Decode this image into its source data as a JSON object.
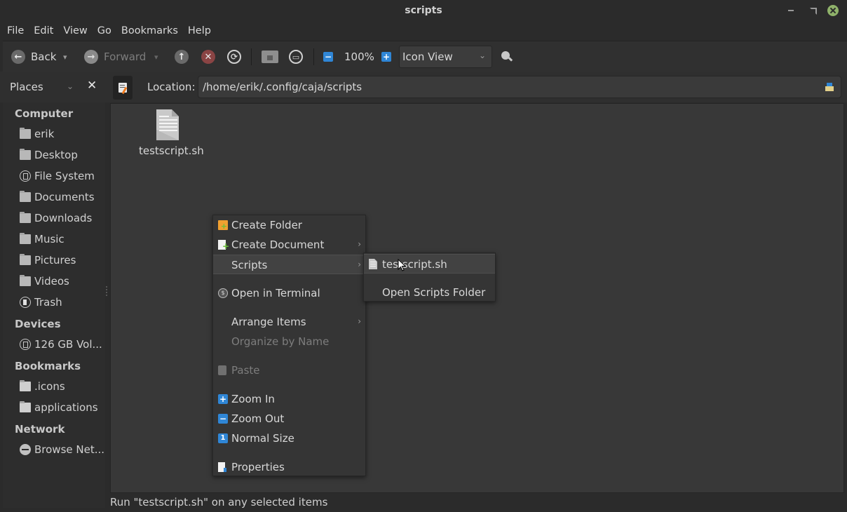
{
  "window": {
    "title": "scripts",
    "controls": {
      "minimize": "minimize-icon",
      "maximize": "maximize-icon",
      "close": "close-icon"
    },
    "close_color": "#8fb26a"
  },
  "menubar": [
    "File",
    "Edit",
    "View",
    "Go",
    "Bookmarks",
    "Help"
  ],
  "toolbar": {
    "back_label": "Back",
    "forward_label": "Forward",
    "zoom_level": "100%",
    "view_mode": "Icon View",
    "icons": [
      "back-icon",
      "forward-icon",
      "up-icon",
      "stop-icon",
      "reload-icon",
      "home-icon",
      "computer-icon",
      "zoom-out-icon",
      "zoom-in-icon",
      "search-icon"
    ]
  },
  "location": {
    "places_label": "Places",
    "label": "Location:",
    "path": "/home/erik/.config/caja/scripts"
  },
  "sidebar": {
    "sections": [
      {
        "title": "Computer",
        "items": [
          {
            "label": "erik",
            "icon": "home-folder-icon"
          },
          {
            "label": "Desktop",
            "icon": "desktop-folder-icon"
          },
          {
            "label": "File System",
            "icon": "drive-icon"
          },
          {
            "label": "Documents",
            "icon": "documents-folder-icon"
          },
          {
            "label": "Downloads",
            "icon": "downloads-folder-icon"
          },
          {
            "label": "Music",
            "icon": "music-folder-icon"
          },
          {
            "label": "Pictures",
            "icon": "pictures-folder-icon"
          },
          {
            "label": "Videos",
            "icon": "videos-folder-icon"
          },
          {
            "label": "Trash",
            "icon": "trash-icon"
          }
        ]
      },
      {
        "title": "Devices",
        "items": [
          {
            "label": "126 GB Vol...",
            "icon": "drive-icon"
          }
        ]
      },
      {
        "title": "Bookmarks",
        "items": [
          {
            "label": ".icons",
            "icon": "folder-icon"
          },
          {
            "label": "applications",
            "icon": "folder-icon"
          }
        ]
      },
      {
        "title": "Network",
        "items": [
          {
            "label": "Browse Net...",
            "icon": "network-icon"
          }
        ]
      }
    ]
  },
  "files": [
    {
      "name": "testscript.sh",
      "icon": "text-file-icon"
    }
  ],
  "context_menu": {
    "items": [
      {
        "label": "Create Folder",
        "icon": "new-folder-icon",
        "submenu": false,
        "disabled": false
      },
      {
        "label": "Create Document",
        "icon": "new-document-icon",
        "submenu": true,
        "disabled": false
      },
      {
        "label": "Scripts",
        "icon": "",
        "submenu": true,
        "disabled": false,
        "highlighted": true
      },
      {
        "label": "Open in Terminal",
        "icon": "terminal-icon",
        "submenu": false,
        "disabled": false
      },
      {
        "label": "Arrange Items",
        "icon": "",
        "submenu": true,
        "disabled": false
      },
      {
        "label": "Organize by Name",
        "icon": "",
        "submenu": false,
        "disabled": true
      },
      {
        "label": "Paste",
        "icon": "paste-icon",
        "submenu": false,
        "disabled": true
      },
      {
        "label": "Zoom In",
        "icon": "zoom-in-icon",
        "submenu": false,
        "disabled": false
      },
      {
        "label": "Zoom Out",
        "icon": "zoom-out-icon",
        "submenu": false,
        "disabled": false
      },
      {
        "label": "Normal Size",
        "icon": "zoom-normal-icon",
        "submenu": false,
        "disabled": false
      },
      {
        "label": "Properties",
        "icon": "properties-icon",
        "submenu": false,
        "disabled": false
      }
    ]
  },
  "scripts_submenu": {
    "items": [
      {
        "label": "testscript.sh",
        "icon": "script-file-icon",
        "highlighted": true
      },
      {
        "label": "Open Scripts Folder",
        "icon": ""
      }
    ]
  },
  "statusbar": {
    "text": "Run \"testscript.sh\" on any selected items"
  },
  "colors": {
    "accent_blue": "#2f86d6",
    "stop_red": "#c0392b",
    "folder_orange": "#f0a030",
    "add_green": "#6bbf3a"
  }
}
